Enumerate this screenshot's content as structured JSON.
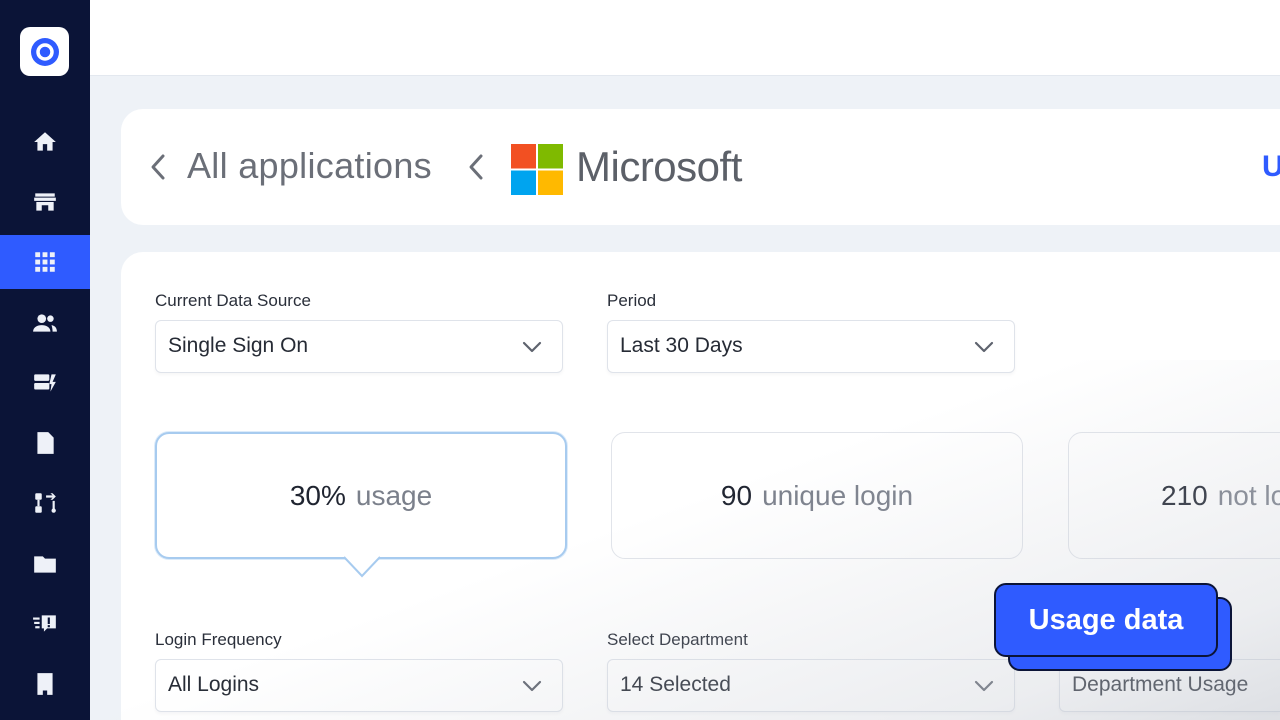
{
  "breadcrumb": {
    "parent": "All applications",
    "current": "Microsoft",
    "right_cut": "U"
  },
  "filters": {
    "data_source": {
      "label": "Current Data Source",
      "value": "Single Sign On"
    },
    "period": {
      "label": "Period",
      "value": "Last 30 Days"
    },
    "login_frequency": {
      "label": "Login Frequency",
      "value": "All Logins"
    },
    "department": {
      "label": "Select Department",
      "value": "14 Selected"
    },
    "department_usage": {
      "value": "Department Usage"
    }
  },
  "stats": [
    {
      "value": "30%",
      "unit": "usage"
    },
    {
      "value": "90",
      "unit": "unique login"
    },
    {
      "value": "210",
      "unit": "not lo"
    }
  ],
  "badge": {
    "label": "Usage data"
  },
  "colors": {
    "sidebar": "#0b1437",
    "accent": "#2f5bff",
    "ms_red": "#f25022",
    "ms_green": "#7fba00",
    "ms_blue": "#00a4ef",
    "ms_yellow": "#ffb900"
  },
  "sidebar": {
    "items": [
      {
        "icon": "home-icon"
      },
      {
        "icon": "store-icon"
      },
      {
        "icon": "apps-grid-icon",
        "active": true
      },
      {
        "icon": "users-icon"
      },
      {
        "icon": "cards-icon"
      },
      {
        "icon": "document-icon"
      },
      {
        "icon": "workflow-icon"
      },
      {
        "icon": "folder-icon"
      },
      {
        "icon": "feedback-icon"
      },
      {
        "icon": "building-icon"
      }
    ]
  }
}
